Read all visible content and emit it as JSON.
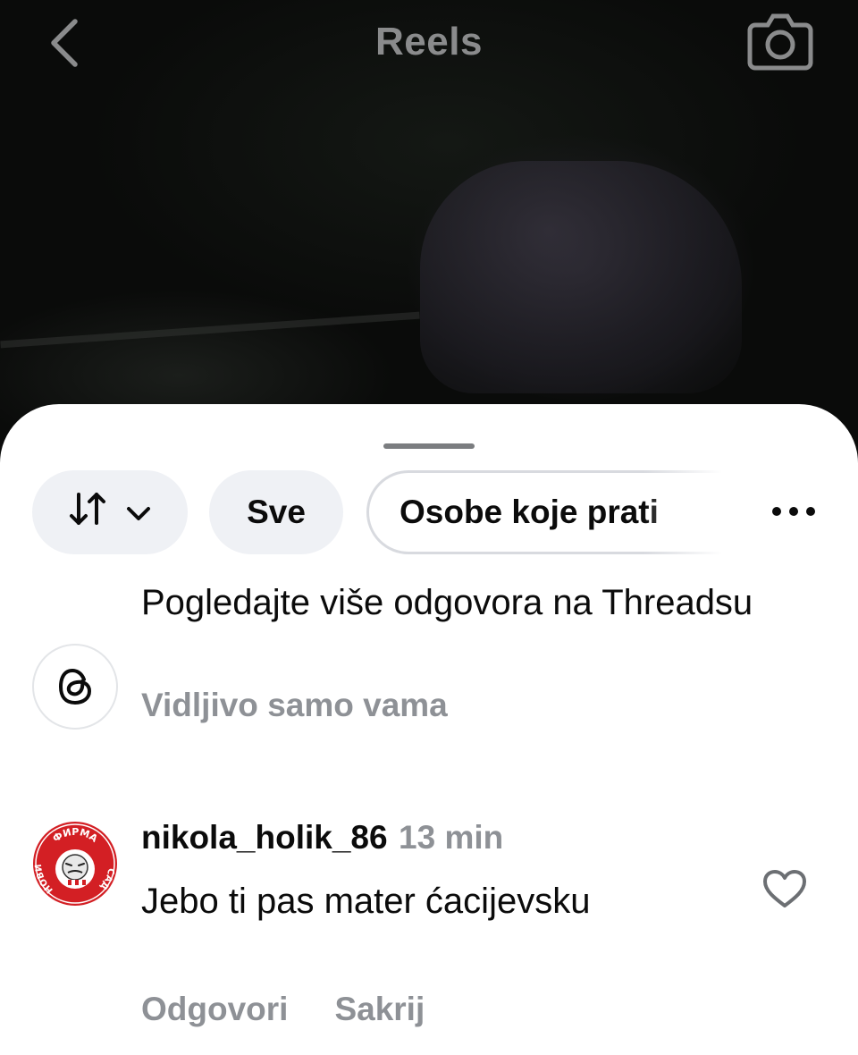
{
  "header": {
    "title": "Reels",
    "back_icon": "chevron-left-icon",
    "camera_icon": "camera-icon"
  },
  "filters": {
    "sort_icon": "sort-arrows-icon",
    "chips": [
      {
        "label": "Sve"
      },
      {
        "label": "Osobe koje prati"
      }
    ],
    "more_icon": "more-horizontal-icon"
  },
  "threads_prompt": {
    "title": "Pogledajte više odgovora na Threadsu",
    "subtitle": "Vidljivo samo vama",
    "icon": "threads-icon"
  },
  "comment": {
    "username": "nikola_holik_86",
    "time": "13 min",
    "text": "Jebo ti pas mater ćacijevsku",
    "avatar": {
      "top_text": "ФИРМА",
      "left_text": "НОВИ",
      "right_text": "САД"
    },
    "actions": {
      "reply": "Odgovori",
      "hide": "Sakrij"
    },
    "like_icon": "heart-outline-icon"
  },
  "colors": {
    "sheet_bg": "#ffffff",
    "chip_bg": "#eff1f5",
    "muted_text": "#8e9196",
    "primary_text": "#0b0b0b",
    "header_text": "#8a8b8c",
    "avatar_red": "#d31f24"
  }
}
